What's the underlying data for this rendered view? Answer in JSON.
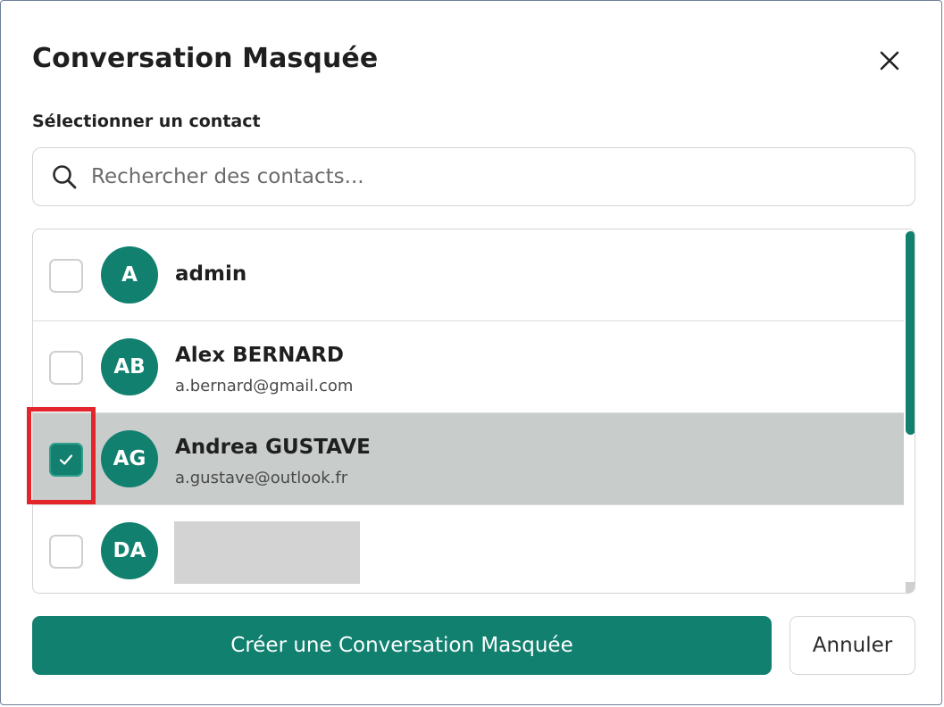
{
  "dialog": {
    "title": "Conversation Masquée",
    "section_label": "Sélectionner un contact"
  },
  "search": {
    "placeholder": "Rechercher des contacts...",
    "value": ""
  },
  "contacts": [
    {
      "initials": "A",
      "name": "admin",
      "email": "",
      "checked": false
    },
    {
      "initials": "AB",
      "name": "Alex BERNARD",
      "email": "a.bernard@gmail.com",
      "checked": false
    },
    {
      "initials": "AG",
      "name": "Andrea GUSTAVE",
      "email": "a.gustave@outlook.fr",
      "checked": true
    },
    {
      "initials": "DA",
      "name": "",
      "email": "",
      "checked": false,
      "redacted": true
    }
  ],
  "actions": {
    "create_label": "Créer une Conversation Masquée",
    "cancel_label": "Annuler"
  },
  "icons": {
    "close": "close-icon",
    "search": "search-icon",
    "check": "check-icon"
  },
  "colors": {
    "accent": "#11806f",
    "selected_row": "#c8cccb",
    "highlight": "#e2252a"
  }
}
